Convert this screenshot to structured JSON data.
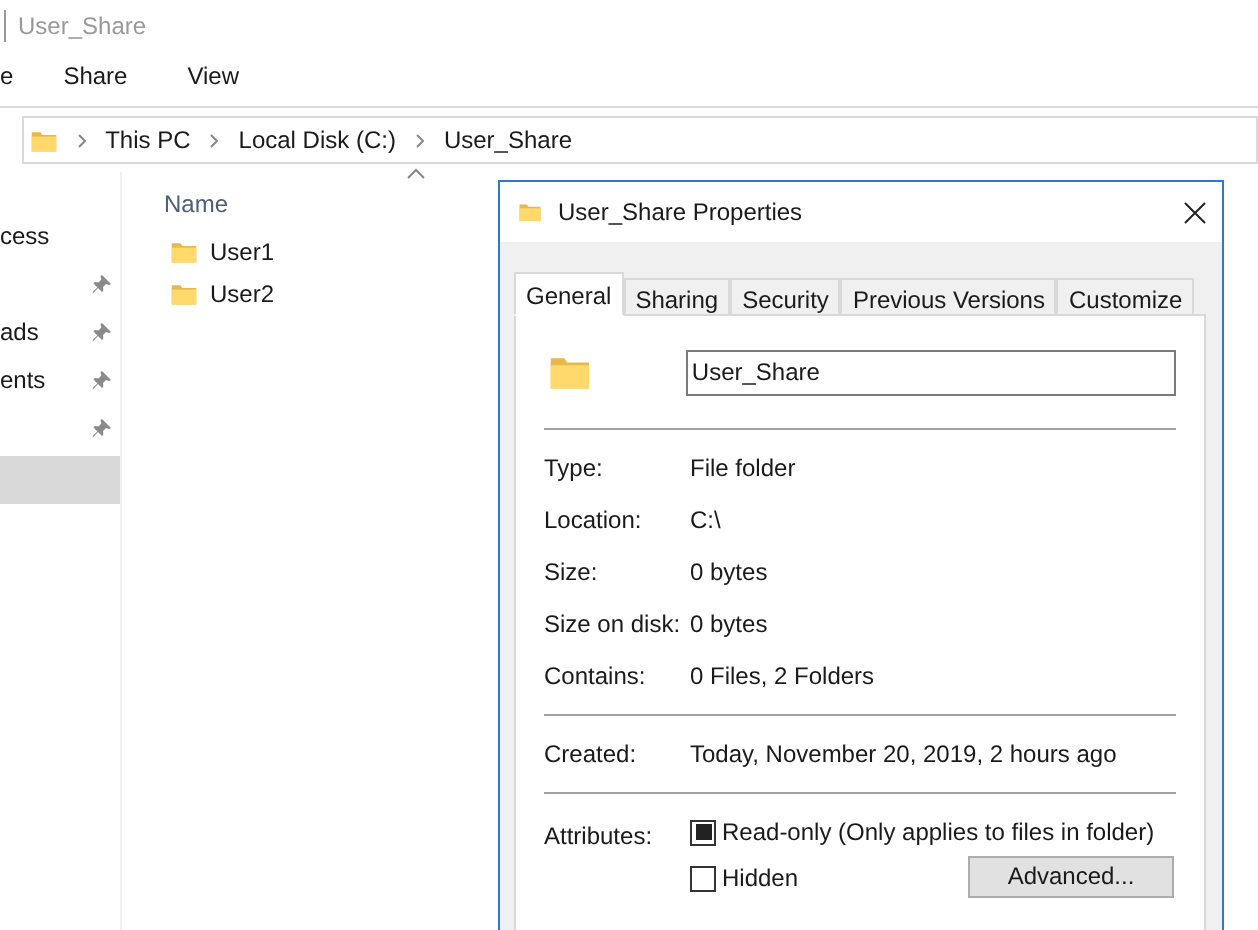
{
  "explorer": {
    "title": "User_Share",
    "ribbon_tabs": [
      "e",
      "Share",
      "View"
    ],
    "breadcrumbs": [
      "This PC",
      "Local Disk (C:)",
      "User_Share"
    ],
    "nav_items": [
      {
        "label": "cess",
        "pinned": false,
        "selected": false
      },
      {
        "pinned": true,
        "selected": false
      },
      {
        "label": "ads",
        "pinned": true,
        "selected": false
      },
      {
        "label": "ents",
        "pinned": true,
        "selected": false
      },
      {
        "pinned": true,
        "selected": false
      },
      {
        "pinned": false,
        "selected": true
      }
    ],
    "column": "Name",
    "files": [
      "User1",
      "User2"
    ]
  },
  "dialog": {
    "title": "User_Share Properties",
    "tabs": [
      {
        "label": "General",
        "selected": true
      },
      {
        "label": "Sharing",
        "selected": false
      },
      {
        "label": "Security",
        "selected": false
      },
      {
        "label": "Previous Versions",
        "selected": false
      },
      {
        "label": "Customize",
        "selected": false
      }
    ],
    "name_value": "User_Share",
    "groups": [
      [
        {
          "label": "Type:",
          "value": "File folder"
        },
        {
          "label": "Location:",
          "value": "C:\\"
        },
        {
          "label": "Size:",
          "value": "0 bytes"
        },
        {
          "label": "Size on disk:",
          "value": "0 bytes"
        },
        {
          "label": "Contains:",
          "value": "0 Files, 2 Folders"
        }
      ],
      [
        {
          "label": "Created:",
          "value": "Today, November 20, 2019, 2 hours ago"
        }
      ]
    ],
    "attributes_label": "Attributes:",
    "attributes": [
      {
        "label": "Read-only (Only applies to files in folder)",
        "checked": false,
        "indeterminate": true
      },
      {
        "label": "Hidden",
        "checked": false,
        "indeterminate": false
      }
    ],
    "advanced_button": "Advanced..."
  }
}
